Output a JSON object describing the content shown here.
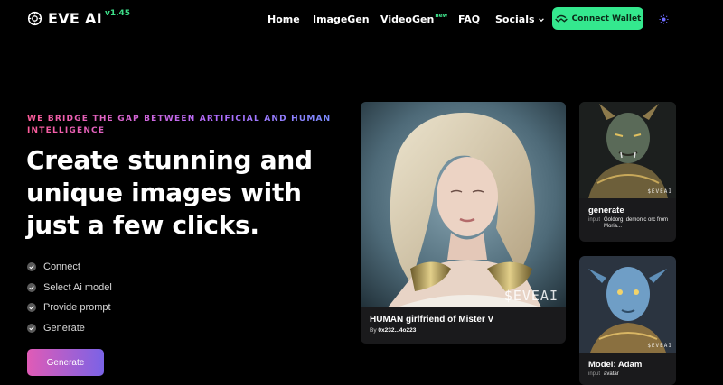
{
  "header": {
    "logo_text": "EVE AI",
    "logo_version": "v1.45",
    "nav": {
      "home": "Home",
      "imagegen": "ImageGen",
      "videogen": "VideoGen",
      "videogen_badge": "new",
      "faq": "FAQ",
      "socials": "Socials"
    },
    "connect_wallet": "Connect Wallet"
  },
  "hero": {
    "tagline": "WE BRIDGE THE GAP BETWEEN ARTIFICIAL AND HUMAN INTELLIGENCE",
    "headline": "Create stunning and unique images with just a few clicks.",
    "steps": [
      "Connect",
      "Select Ai model",
      "Provide prompt",
      "Generate"
    ],
    "generate_button": "Generate"
  },
  "cards": {
    "main": {
      "title": "HUMAN girlfriend of Mister V",
      "by_label": "By",
      "by_value": "0x232...4o223",
      "watermark": "$EVEAI"
    },
    "small1": {
      "title": "generate",
      "input_label": "input",
      "input_value": "Goldorg, demonic orc from Moria...",
      "watermark": "$EVEAI"
    },
    "small2": {
      "title": "Model: Adam",
      "input_label": "input",
      "input_value": "avatar",
      "watermark": "$EVEAI"
    }
  },
  "colors": {
    "accent_green": "#34e88e",
    "generate_gradient_start": "#e05bb6",
    "generate_gradient_end": "#7a63e6"
  }
}
